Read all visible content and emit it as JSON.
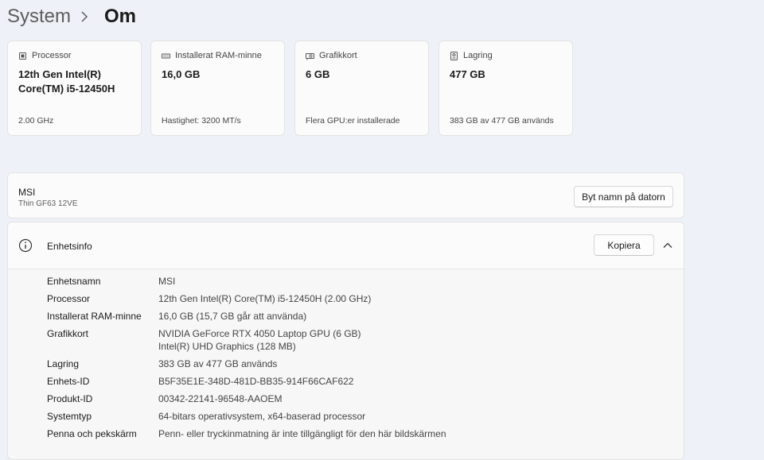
{
  "breadcrumb": {
    "parent": "System",
    "current": "Om"
  },
  "cards": [
    {
      "icon": "processor-icon",
      "label": "Processor",
      "value": "12th Gen Intel(R) Core(TM) i5-12450H",
      "sub": "2.00 GHz"
    },
    {
      "icon": "ram-icon",
      "label": "Installerat RAM-minne",
      "value": "16,0 GB",
      "sub": "Hastighet: 3200 MT/s"
    },
    {
      "icon": "gpu-icon",
      "label": "Grafikkort",
      "value": "6 GB",
      "sub": "Flera GPU:er installerade"
    },
    {
      "icon": "storage-icon",
      "label": "Lagring",
      "value": "477 GB",
      "sub": "383 GB av 477 GB används"
    }
  ],
  "device": {
    "name": "MSI",
    "model": "Thin GF63 12VE",
    "rename_label": "Byt namn på datorn"
  },
  "device_info": {
    "title": "Enhetsinfo",
    "copy_label": "Kopiera",
    "rows": [
      {
        "key": "Enhetsnamn",
        "value": "MSI"
      },
      {
        "key": "Processor",
        "value": "12th Gen Intel(R) Core(TM) i5-12450H (2.00 GHz)"
      },
      {
        "key": "Installerat RAM-minne",
        "value": "16,0 GB (15,7 GB går att använda)"
      },
      {
        "key": "Grafikkort",
        "value": "NVIDIA GeForce RTX 4050 Laptop GPU (6 GB)",
        "value2": "Intel(R) UHD Graphics (128 MB)"
      },
      {
        "key": "Lagring",
        "value": "383 GB av 477 GB används"
      },
      {
        "key": "Enhets-ID",
        "value": "B5F35E1E-348D-481D-BB35-914F66CAF622"
      },
      {
        "key": "Produkt-ID",
        "value": "00342-22141-96548-AAOEM"
      },
      {
        "key": "Systemtyp",
        "value": "64-bitars operativsystem, x64-baserad processor"
      },
      {
        "key": "Penna och pekskärm",
        "value": "Penn- eller tryckinmatning är inte tillgängligt för den här bildskärmen"
      }
    ]
  }
}
